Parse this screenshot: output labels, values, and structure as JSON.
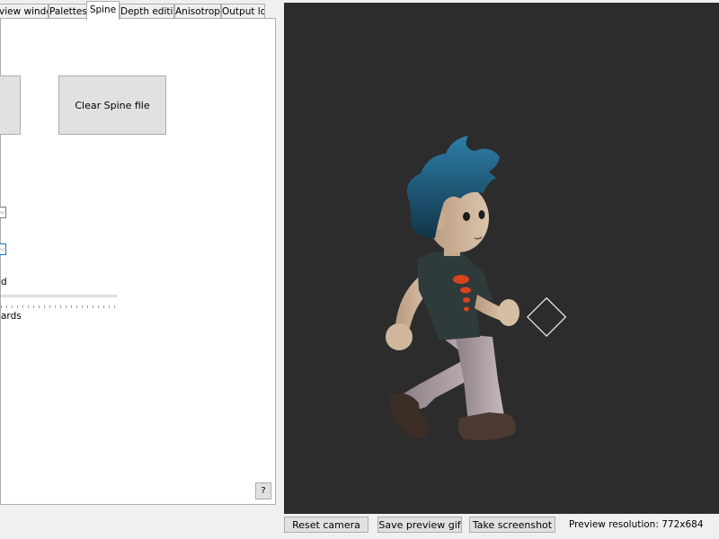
{
  "tabs": [
    {
      "label": "view window"
    },
    {
      "label": "Palettes"
    },
    {
      "label": "Spine"
    },
    {
      "label": "Depth editing"
    },
    {
      "label": "Anisotropy"
    },
    {
      "label": "Output log"
    }
  ],
  "spine_panel": {
    "clear_button_label": "Clear Spine file",
    "label_partial_1": "d",
    "label_partial_2": "ards",
    "help_label": "?"
  },
  "bottom_bar": {
    "reset_camera_label": "Reset camera",
    "save_gif_label": "Save preview gif",
    "screenshot_label": "Take screenshot",
    "resolution_text": "Preview resolution: 772x684"
  },
  "viewport": {
    "background_color": "#2c2c2c",
    "subject": "animated-character-walking",
    "gizmo": "diamond-outline"
  },
  "colors": {
    "accent_focus": "#0078d7",
    "tab_body_bg": "#ffffff",
    "window_bg": "#f0f0f0"
  }
}
